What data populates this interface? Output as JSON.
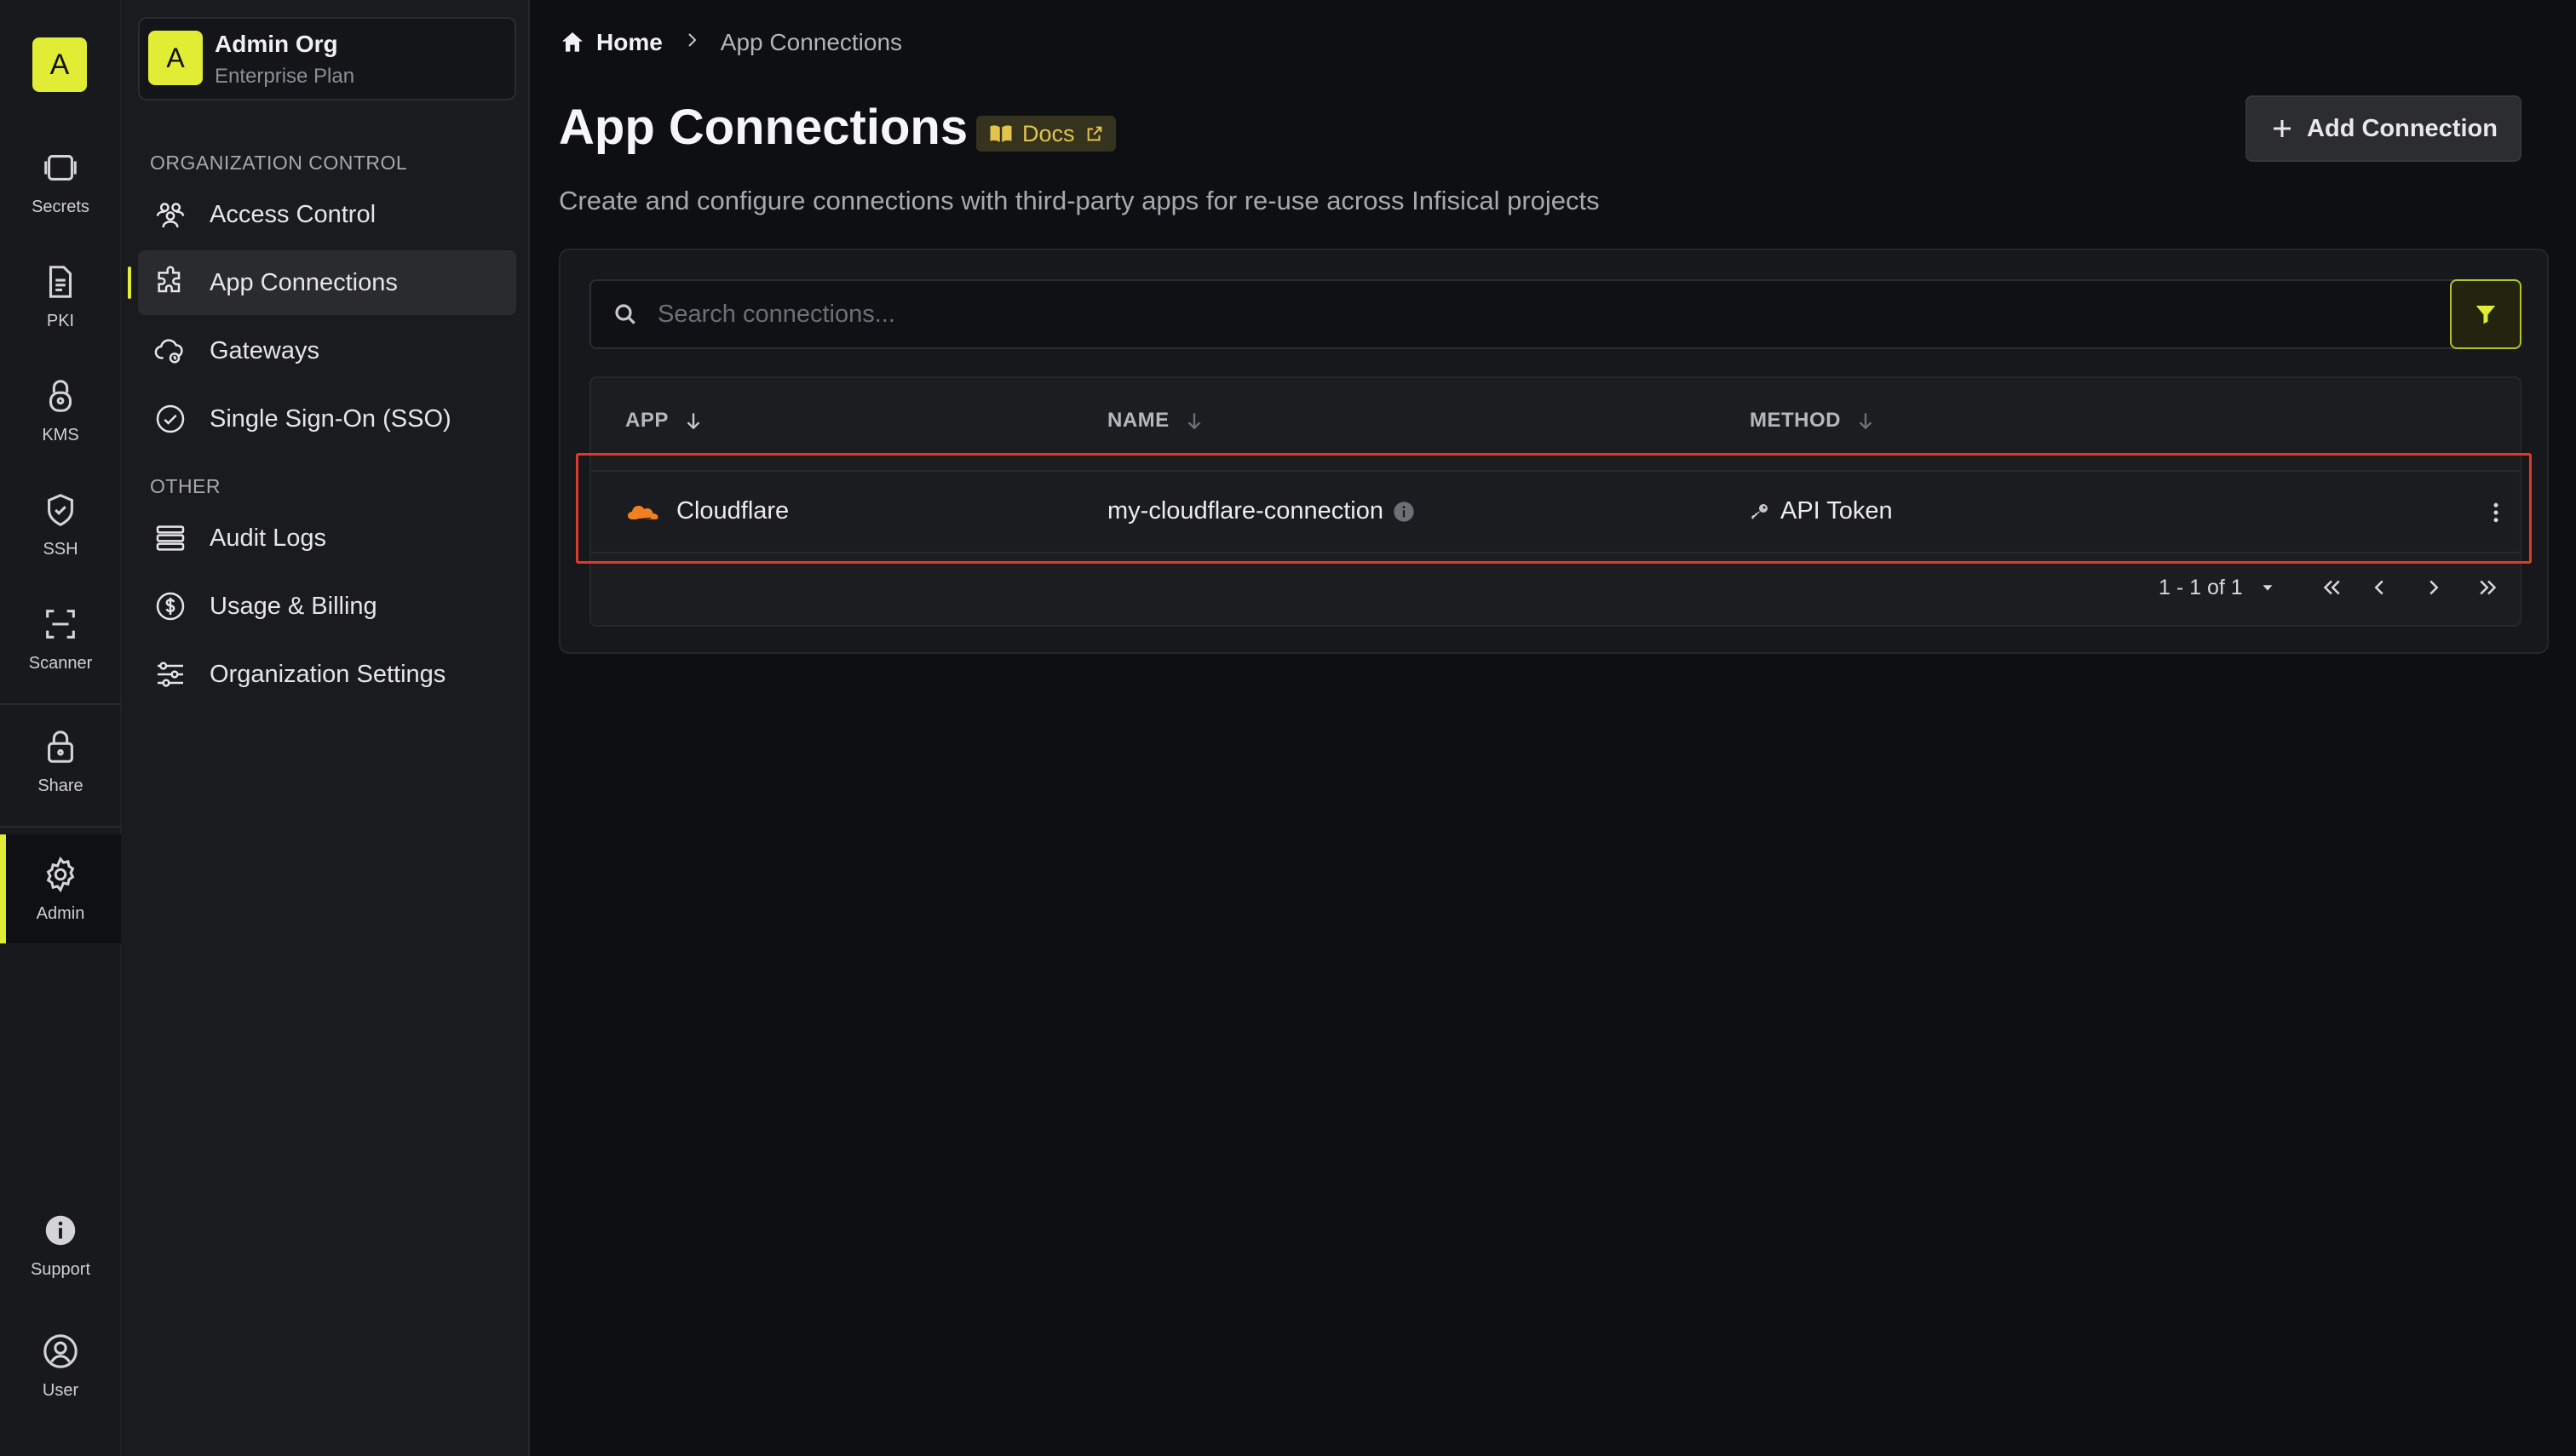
{
  "rail": {
    "logo_letter": "A",
    "items": [
      {
        "label": "Secrets",
        "icon": "vault-icon"
      },
      {
        "label": "PKI",
        "icon": "document-icon"
      },
      {
        "label": "KMS",
        "icon": "lock-shield-icon"
      },
      {
        "label": "SSH",
        "icon": "shield-check-icon"
      },
      {
        "label": "Scanner",
        "icon": "scan-icon"
      },
      {
        "label": "Share",
        "icon": "lock-icon"
      },
      {
        "label": "Admin",
        "icon": "gear-icon"
      },
      {
        "label": "Support",
        "icon": "info-icon"
      },
      {
        "label": "User",
        "icon": "user-circle-icon"
      }
    ],
    "active": "Admin"
  },
  "org": {
    "avatar_letter": "A",
    "name": "Admin Org",
    "plan": "Enterprise Plan"
  },
  "sidebar": {
    "section_org": "ORGANIZATION CONTROL",
    "section_other": "OTHER",
    "items": [
      {
        "label": "Access Control",
        "icon": "users-icon"
      },
      {
        "label": "App Connections",
        "icon": "puzzle-icon"
      },
      {
        "label": "Gateways",
        "icon": "cloud-gateway-icon"
      },
      {
        "label": "Single Sign-On (SSO)",
        "icon": "check-circle-icon"
      },
      {
        "label": "Audit Logs",
        "icon": "list-icon"
      },
      {
        "label": "Usage & Billing",
        "icon": "dollar-circle-icon"
      },
      {
        "label": "Organization Settings",
        "icon": "sliders-icon"
      }
    ],
    "active": "App Connections"
  },
  "breadcrumb": {
    "home": "Home",
    "current": "App Connections"
  },
  "page": {
    "title": "App Connections",
    "docs_label": "Docs",
    "subtitle": "Create and configure connections with third-party apps for re-use across Infisical projects",
    "add_button": "Add Connection"
  },
  "search": {
    "placeholder": "Search connections..."
  },
  "table": {
    "columns": [
      "APP",
      "NAME",
      "METHOD"
    ],
    "rows": [
      {
        "app": "Cloudflare",
        "name": "my-cloudflare-connection",
        "method": "API Token"
      }
    ]
  },
  "pagination": {
    "range_text": "1 - 1 of 1"
  },
  "colors": {
    "accent": "#e0ed34",
    "highlight": "#e0392b",
    "cloudflare": "#f38020"
  }
}
